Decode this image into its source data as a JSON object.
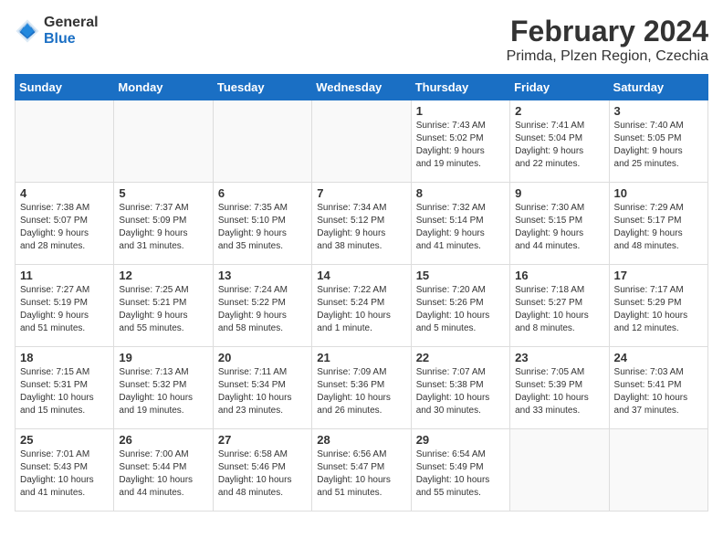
{
  "header": {
    "logo_line1": "General",
    "logo_line2": "Blue",
    "title": "February 2024",
    "subtitle": "Primda, Plzen Region, Czechia"
  },
  "calendar": {
    "days_of_week": [
      "Sunday",
      "Monday",
      "Tuesday",
      "Wednesday",
      "Thursday",
      "Friday",
      "Saturday"
    ],
    "weeks": [
      [
        {
          "day": "",
          "detail": ""
        },
        {
          "day": "",
          "detail": ""
        },
        {
          "day": "",
          "detail": ""
        },
        {
          "day": "",
          "detail": ""
        },
        {
          "day": "1",
          "detail": "Sunrise: 7:43 AM\nSunset: 5:02 PM\nDaylight: 9 hours\nand 19 minutes."
        },
        {
          "day": "2",
          "detail": "Sunrise: 7:41 AM\nSunset: 5:04 PM\nDaylight: 9 hours\nand 22 minutes."
        },
        {
          "day": "3",
          "detail": "Sunrise: 7:40 AM\nSunset: 5:05 PM\nDaylight: 9 hours\nand 25 minutes."
        }
      ],
      [
        {
          "day": "4",
          "detail": "Sunrise: 7:38 AM\nSunset: 5:07 PM\nDaylight: 9 hours\nand 28 minutes."
        },
        {
          "day": "5",
          "detail": "Sunrise: 7:37 AM\nSunset: 5:09 PM\nDaylight: 9 hours\nand 31 minutes."
        },
        {
          "day": "6",
          "detail": "Sunrise: 7:35 AM\nSunset: 5:10 PM\nDaylight: 9 hours\nand 35 minutes."
        },
        {
          "day": "7",
          "detail": "Sunrise: 7:34 AM\nSunset: 5:12 PM\nDaylight: 9 hours\nand 38 minutes."
        },
        {
          "day": "8",
          "detail": "Sunrise: 7:32 AM\nSunset: 5:14 PM\nDaylight: 9 hours\nand 41 minutes."
        },
        {
          "day": "9",
          "detail": "Sunrise: 7:30 AM\nSunset: 5:15 PM\nDaylight: 9 hours\nand 44 minutes."
        },
        {
          "day": "10",
          "detail": "Sunrise: 7:29 AM\nSunset: 5:17 PM\nDaylight: 9 hours\nand 48 minutes."
        }
      ],
      [
        {
          "day": "11",
          "detail": "Sunrise: 7:27 AM\nSunset: 5:19 PM\nDaylight: 9 hours\nand 51 minutes."
        },
        {
          "day": "12",
          "detail": "Sunrise: 7:25 AM\nSunset: 5:21 PM\nDaylight: 9 hours\nand 55 minutes."
        },
        {
          "day": "13",
          "detail": "Sunrise: 7:24 AM\nSunset: 5:22 PM\nDaylight: 9 hours\nand 58 minutes."
        },
        {
          "day": "14",
          "detail": "Sunrise: 7:22 AM\nSunset: 5:24 PM\nDaylight: 10 hours\nand 1 minute."
        },
        {
          "day": "15",
          "detail": "Sunrise: 7:20 AM\nSunset: 5:26 PM\nDaylight: 10 hours\nand 5 minutes."
        },
        {
          "day": "16",
          "detail": "Sunrise: 7:18 AM\nSunset: 5:27 PM\nDaylight: 10 hours\nand 8 minutes."
        },
        {
          "day": "17",
          "detail": "Sunrise: 7:17 AM\nSunset: 5:29 PM\nDaylight: 10 hours\nand 12 minutes."
        }
      ],
      [
        {
          "day": "18",
          "detail": "Sunrise: 7:15 AM\nSunset: 5:31 PM\nDaylight: 10 hours\nand 15 minutes."
        },
        {
          "day": "19",
          "detail": "Sunrise: 7:13 AM\nSunset: 5:32 PM\nDaylight: 10 hours\nand 19 minutes."
        },
        {
          "day": "20",
          "detail": "Sunrise: 7:11 AM\nSunset: 5:34 PM\nDaylight: 10 hours\nand 23 minutes."
        },
        {
          "day": "21",
          "detail": "Sunrise: 7:09 AM\nSunset: 5:36 PM\nDaylight: 10 hours\nand 26 minutes."
        },
        {
          "day": "22",
          "detail": "Sunrise: 7:07 AM\nSunset: 5:38 PM\nDaylight: 10 hours\nand 30 minutes."
        },
        {
          "day": "23",
          "detail": "Sunrise: 7:05 AM\nSunset: 5:39 PM\nDaylight: 10 hours\nand 33 minutes."
        },
        {
          "day": "24",
          "detail": "Sunrise: 7:03 AM\nSunset: 5:41 PM\nDaylight: 10 hours\nand 37 minutes."
        }
      ],
      [
        {
          "day": "25",
          "detail": "Sunrise: 7:01 AM\nSunset: 5:43 PM\nDaylight: 10 hours\nand 41 minutes."
        },
        {
          "day": "26",
          "detail": "Sunrise: 7:00 AM\nSunset: 5:44 PM\nDaylight: 10 hours\nand 44 minutes."
        },
        {
          "day": "27",
          "detail": "Sunrise: 6:58 AM\nSunset: 5:46 PM\nDaylight: 10 hours\nand 48 minutes."
        },
        {
          "day": "28",
          "detail": "Sunrise: 6:56 AM\nSunset: 5:47 PM\nDaylight: 10 hours\nand 51 minutes."
        },
        {
          "day": "29",
          "detail": "Sunrise: 6:54 AM\nSunset: 5:49 PM\nDaylight: 10 hours\nand 55 minutes."
        },
        {
          "day": "",
          "detail": ""
        },
        {
          "day": "",
          "detail": ""
        }
      ]
    ]
  }
}
